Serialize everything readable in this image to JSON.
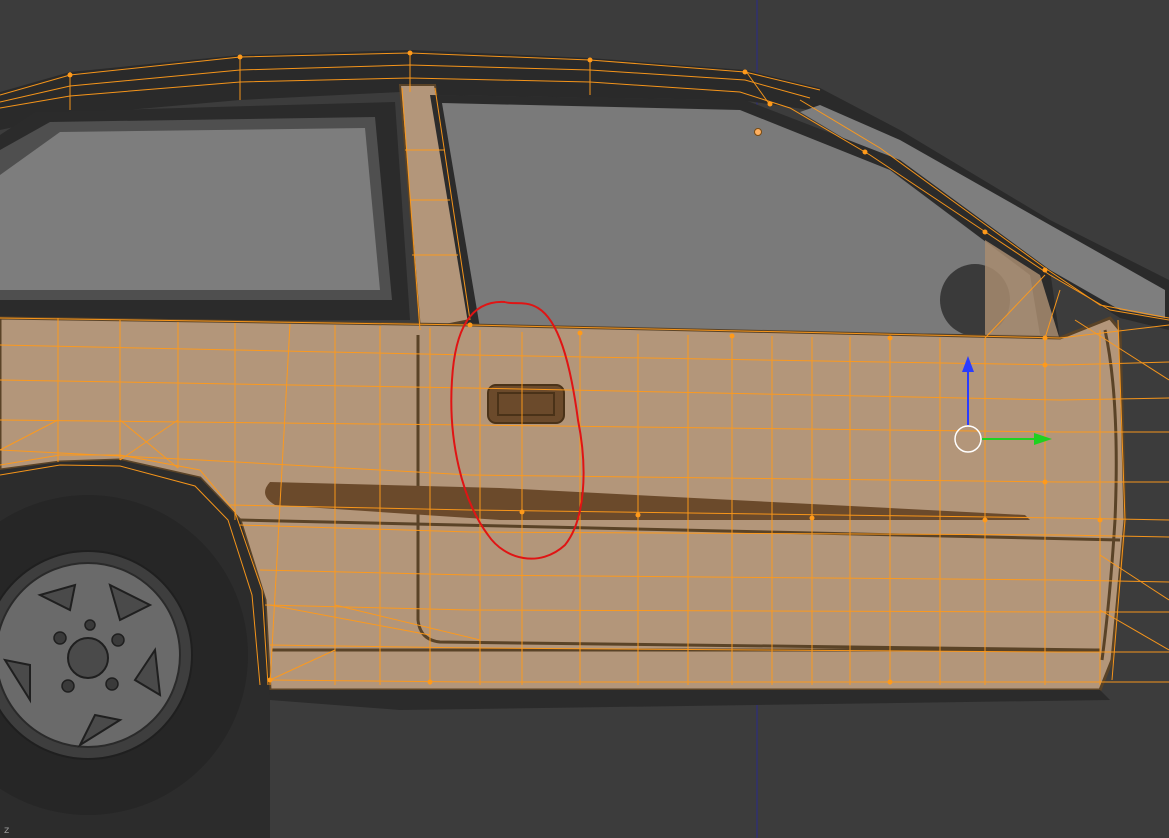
{
  "viewport": {
    "axis_label": "z"
  },
  "colors": {
    "background": "#3c3c3c",
    "body_paint": "#b3967a",
    "body_outline": "#5a4327",
    "trim_dark": "#6b4a2b",
    "glass": "#7a7a7a",
    "frame_dark": "#2a2a2a",
    "frame_mid": "#4e4e4e",
    "wireframe": "#ff9a1a",
    "annotation": "#e01414",
    "gizmo_z": "#2a3cff",
    "gizmo_y": "#1fd21f",
    "gizmo_center": "#ffffff",
    "center_line": "#2a2a8a"
  },
  "icons": {
    "transform_gizmo": "transform-gizmo-icon",
    "vertex": "vertex-dot-icon"
  }
}
